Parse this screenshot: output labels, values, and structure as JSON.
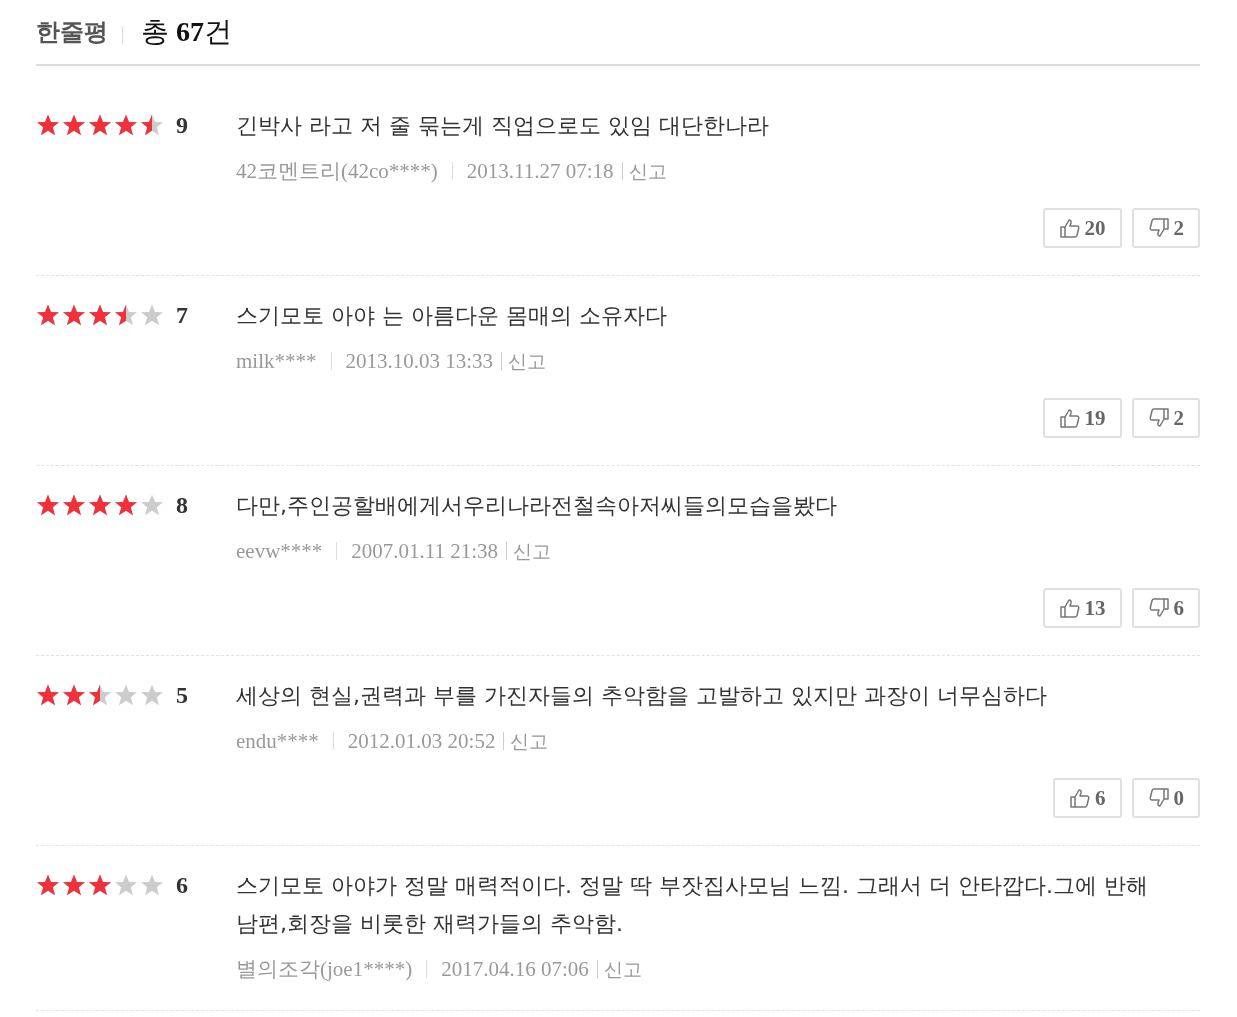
{
  "header": {
    "title": "한줄평",
    "total": "총 **67**건"
  },
  "reviews": [
    {
      "stars": 4.5,
      "score": "9",
      "text": "긴박사 라고 저 줄 묶는게 직업으로도 있임 대단한나라",
      "author": "42코멘트리(42co****)",
      "date": "2013.11.27 07:18",
      "report": "신고",
      "likes": "20",
      "dislikes": "2"
    },
    {
      "stars": 3.5,
      "score": "7",
      "text": "스기모토 아야 는 아름다운 몸매의 소유자다",
      "author": "milk****",
      "date": "2013.10.03 13:33",
      "report": "신고",
      "likes": "19",
      "dislikes": "2"
    },
    {
      "stars": 4,
      "score": "8",
      "text": "다만,주인공할배에게서우리나라전철속아저씨들의모습을봤다",
      "author": "eevw****",
      "date": "2007.01.11 21:38",
      "report": "신고",
      "likes": "13",
      "dislikes": "6"
    },
    {
      "stars": 2.5,
      "score": "5",
      "text": "세상의 현실,권력과 부를 가진자들의 추악함을 고발하고 있지만 과장이 너무심하다",
      "author": "endu****",
      "date": "2012.01.03 20:52",
      "report": "신고",
      "likes": "6",
      "dislikes": "0"
    },
    {
      "stars": 3,
      "score": "6",
      "text": "스기모토 아야가 정말 매력적이다. 정말 딱 부잣집사모님 느낌. 그래서 더 안타깝다.그에 반해 남편,회장을 비롯한 재력가들의 추악함.",
      "author": "별의조각(joe1****)",
      "date": "2017.04.16 07:06",
      "report": "신고"
    }
  ]
}
